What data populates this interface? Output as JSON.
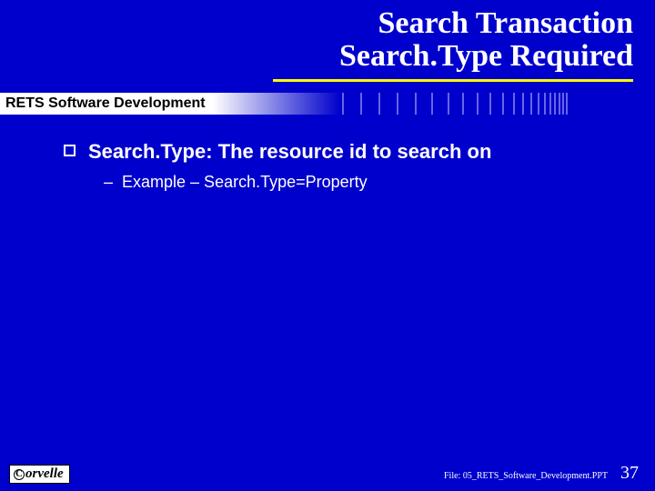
{
  "title": {
    "line1": "Search Transaction",
    "line2": "Search.Type Required"
  },
  "subtitle": "RETS Software Development",
  "content": {
    "bullet1": "Search.Type: The resource id to search on",
    "sub1": "Example – Search.Type=Property"
  },
  "footer": {
    "logo_text": "orvelle",
    "file": "File: 05_RETS_Software_Development.PPT",
    "page": "37"
  }
}
